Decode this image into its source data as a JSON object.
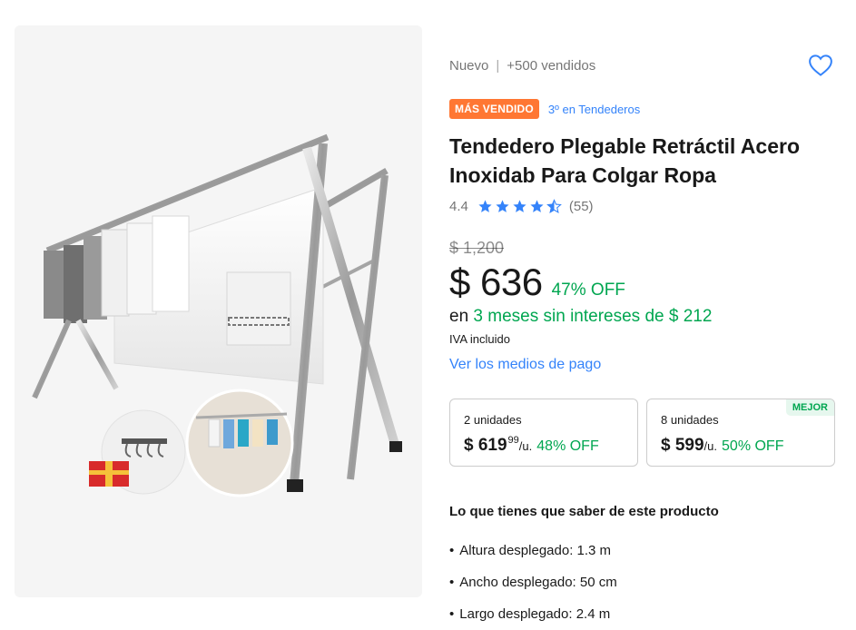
{
  "product": {
    "condition": "Nuevo",
    "sold": "+500 vendidos",
    "badge": "MÁS VENDIDO",
    "ranking": "3º en Tendederos",
    "title": "Tendedero Plegable Retráctil Acero Inoxidab Para Colgar Ropa",
    "rating": "4.4",
    "rating_value": 4.4,
    "reviews": "(55)",
    "favorite_icon": "heart-outline-icon"
  },
  "pricing": {
    "old_price": "$ 1,200",
    "price": "$ 636",
    "discount": "47% OFF",
    "installments_prefix": "en ",
    "installments": "3 meses sin intereses de $ 212",
    "tax_note": "IVA incluido",
    "payment_link": "Ver los medios de pago"
  },
  "quantity_offers": [
    {
      "label": "2 unidades",
      "price": "$ 619",
      "cents": "99",
      "unit": "/u.",
      "discount": "48% OFF",
      "tag": ""
    },
    {
      "label": "8 unidades",
      "price": "$ 599",
      "cents": "",
      "unit": "/u.",
      "discount": "50% OFF",
      "tag": "MEJOR"
    }
  ],
  "highlights": {
    "title": "Lo que tienes que saber de este producto",
    "items": [
      "Altura desplegado: 1.3 m",
      "Ancho desplegado: 50 cm",
      "Largo desplegado: 2.4 m"
    ]
  },
  "colors": {
    "accent": "#3483fa",
    "green": "#00a650",
    "badge": "#ff7733"
  }
}
